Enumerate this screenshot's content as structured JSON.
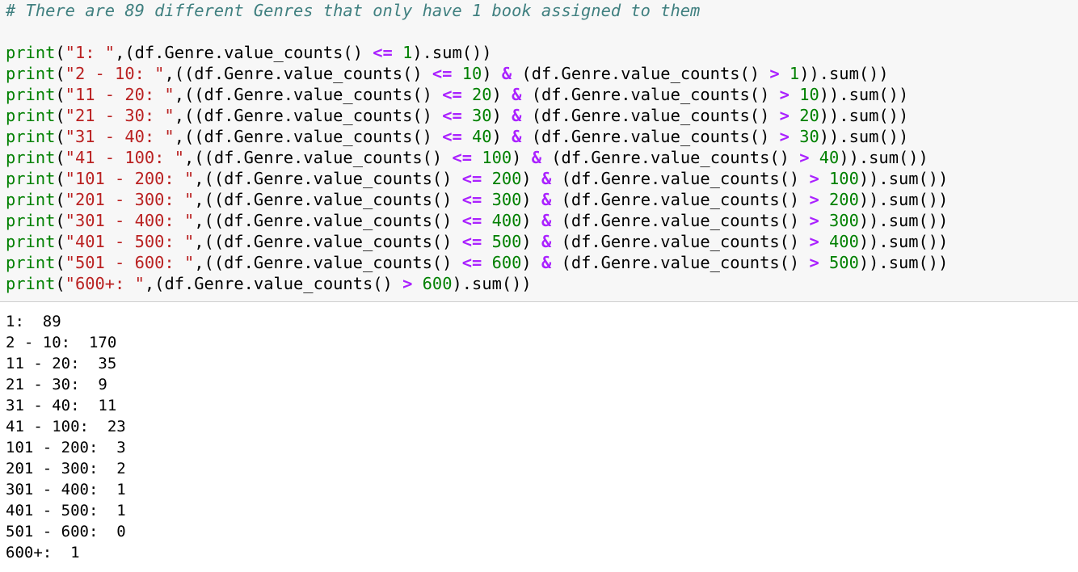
{
  "cell": {
    "comment": "# There are 89 different Genres that only have 1 book assigned to them",
    "code": [
      [
        [
          "kw",
          "print"
        ],
        [
          "t",
          "("
        ],
        [
          "str",
          "\"1: \""
        ],
        [
          "t",
          ",(df.Genre.value_counts() "
        ],
        [
          "op",
          "<="
        ],
        [
          "t",
          " "
        ],
        [
          "num",
          "1"
        ],
        [
          "t",
          ").sum())"
        ]
      ],
      [
        [
          "kw",
          "print"
        ],
        [
          "t",
          "("
        ],
        [
          "str",
          "\"2 - 10: \""
        ],
        [
          "t",
          ",((df.Genre.value_counts() "
        ],
        [
          "op",
          "<="
        ],
        [
          "t",
          " "
        ],
        [
          "num",
          "10"
        ],
        [
          "t",
          ") "
        ],
        [
          "op",
          "&"
        ],
        [
          "t",
          " (df.Genre.value_counts() "
        ],
        [
          "op",
          ">"
        ],
        [
          "t",
          " "
        ],
        [
          "num",
          "1"
        ],
        [
          "t",
          ")).sum())"
        ]
      ],
      [
        [
          "kw",
          "print"
        ],
        [
          "t",
          "("
        ],
        [
          "str",
          "\"11 - 20: \""
        ],
        [
          "t",
          ",((df.Genre.value_counts() "
        ],
        [
          "op",
          "<="
        ],
        [
          "t",
          " "
        ],
        [
          "num",
          "20"
        ],
        [
          "t",
          ") "
        ],
        [
          "op",
          "&"
        ],
        [
          "t",
          " (df.Genre.value_counts() "
        ],
        [
          "op",
          ">"
        ],
        [
          "t",
          " "
        ],
        [
          "num",
          "10"
        ],
        [
          "t",
          ")).sum())"
        ]
      ],
      [
        [
          "kw",
          "print"
        ],
        [
          "t",
          "("
        ],
        [
          "str",
          "\"21 - 30: \""
        ],
        [
          "t",
          ",((df.Genre.value_counts() "
        ],
        [
          "op",
          "<="
        ],
        [
          "t",
          " "
        ],
        [
          "num",
          "30"
        ],
        [
          "t",
          ") "
        ],
        [
          "op",
          "&"
        ],
        [
          "t",
          " (df.Genre.value_counts() "
        ],
        [
          "op",
          ">"
        ],
        [
          "t",
          " "
        ],
        [
          "num",
          "20"
        ],
        [
          "t",
          ")).sum())"
        ]
      ],
      [
        [
          "kw",
          "print"
        ],
        [
          "t",
          "("
        ],
        [
          "str",
          "\"31 - 40: \""
        ],
        [
          "t",
          ",((df.Genre.value_counts() "
        ],
        [
          "op",
          "<="
        ],
        [
          "t",
          " "
        ],
        [
          "num",
          "40"
        ],
        [
          "t",
          ") "
        ],
        [
          "op",
          "&"
        ],
        [
          "t",
          " (df.Genre.value_counts() "
        ],
        [
          "op",
          ">"
        ],
        [
          "t",
          " "
        ],
        [
          "num",
          "30"
        ],
        [
          "t",
          ")).sum())"
        ]
      ],
      [
        [
          "kw",
          "print"
        ],
        [
          "t",
          "("
        ],
        [
          "str",
          "\"41 - 100: \""
        ],
        [
          "t",
          ",((df.Genre.value_counts() "
        ],
        [
          "op",
          "<="
        ],
        [
          "t",
          " "
        ],
        [
          "num",
          "100"
        ],
        [
          "t",
          ") "
        ],
        [
          "op",
          "&"
        ],
        [
          "t",
          " (df.Genre.value_counts() "
        ],
        [
          "op",
          ">"
        ],
        [
          "t",
          " "
        ],
        [
          "num",
          "40"
        ],
        [
          "t",
          ")).sum())"
        ]
      ],
      [
        [
          "kw",
          "print"
        ],
        [
          "t",
          "("
        ],
        [
          "str",
          "\"101 - 200: \""
        ],
        [
          "t",
          ",((df.Genre.value_counts() "
        ],
        [
          "op",
          "<="
        ],
        [
          "t",
          " "
        ],
        [
          "num",
          "200"
        ],
        [
          "t",
          ") "
        ],
        [
          "op",
          "&"
        ],
        [
          "t",
          " (df.Genre.value_counts() "
        ],
        [
          "op",
          ">"
        ],
        [
          "t",
          " "
        ],
        [
          "num",
          "100"
        ],
        [
          "t",
          ")).sum())"
        ]
      ],
      [
        [
          "kw",
          "print"
        ],
        [
          "t",
          "("
        ],
        [
          "str",
          "\"201 - 300: \""
        ],
        [
          "t",
          ",((df.Genre.value_counts() "
        ],
        [
          "op",
          "<="
        ],
        [
          "t",
          " "
        ],
        [
          "num",
          "300"
        ],
        [
          "t",
          ") "
        ],
        [
          "op",
          "&"
        ],
        [
          "t",
          " (df.Genre.value_counts() "
        ],
        [
          "op",
          ">"
        ],
        [
          "t",
          " "
        ],
        [
          "num",
          "200"
        ],
        [
          "t",
          ")).sum())"
        ]
      ],
      [
        [
          "kw",
          "print"
        ],
        [
          "t",
          "("
        ],
        [
          "str",
          "\"301 - 400: \""
        ],
        [
          "t",
          ",((df.Genre.value_counts() "
        ],
        [
          "op",
          "<="
        ],
        [
          "t",
          " "
        ],
        [
          "num",
          "400"
        ],
        [
          "t",
          ") "
        ],
        [
          "op",
          "&"
        ],
        [
          "t",
          " (df.Genre.value_counts() "
        ],
        [
          "op",
          ">"
        ],
        [
          "t",
          " "
        ],
        [
          "num",
          "300"
        ],
        [
          "t",
          ")).sum())"
        ]
      ],
      [
        [
          "kw",
          "print"
        ],
        [
          "t",
          "("
        ],
        [
          "str",
          "\"401 - 500: \""
        ],
        [
          "t",
          ",((df.Genre.value_counts() "
        ],
        [
          "op",
          "<="
        ],
        [
          "t",
          " "
        ],
        [
          "num",
          "500"
        ],
        [
          "t",
          ") "
        ],
        [
          "op",
          "&"
        ],
        [
          "t",
          " (df.Genre.value_counts() "
        ],
        [
          "op",
          ">"
        ],
        [
          "t",
          " "
        ],
        [
          "num",
          "400"
        ],
        [
          "t",
          ")).sum())"
        ]
      ],
      [
        [
          "kw",
          "print"
        ],
        [
          "t",
          "("
        ],
        [
          "str",
          "\"501 - 600: \""
        ],
        [
          "t",
          ",((df.Genre.value_counts() "
        ],
        [
          "op",
          "<="
        ],
        [
          "t",
          " "
        ],
        [
          "num",
          "600"
        ],
        [
          "t",
          ") "
        ],
        [
          "op",
          "&"
        ],
        [
          "t",
          " (df.Genre.value_counts() "
        ],
        [
          "op",
          ">"
        ],
        [
          "t",
          " "
        ],
        [
          "num",
          "500"
        ],
        [
          "t",
          ")).sum())"
        ]
      ],
      [
        [
          "kw",
          "print"
        ],
        [
          "t",
          "("
        ],
        [
          "str",
          "\"600+: \""
        ],
        [
          "t",
          ",(df.Genre.value_counts() "
        ],
        [
          "op",
          ">"
        ],
        [
          "t",
          " "
        ],
        [
          "num",
          "600"
        ],
        [
          "t",
          ").sum())"
        ]
      ]
    ]
  },
  "output": [
    "1:  89",
    "2 - 10:  170",
    "11 - 20:  35",
    "21 - 30:  9",
    "31 - 40:  11",
    "41 - 100:  23",
    "101 - 200:  3",
    "201 - 300:  2",
    "301 - 400:  1",
    "401 - 500:  1",
    "501 - 600:  0",
    "600+:  1"
  ],
  "colors": {
    "comment": "#408080",
    "keyword": "#008000",
    "string": "#ba2121",
    "number": "#008000",
    "operator": "#aa22ff",
    "input_background": "#f7f7f7"
  }
}
